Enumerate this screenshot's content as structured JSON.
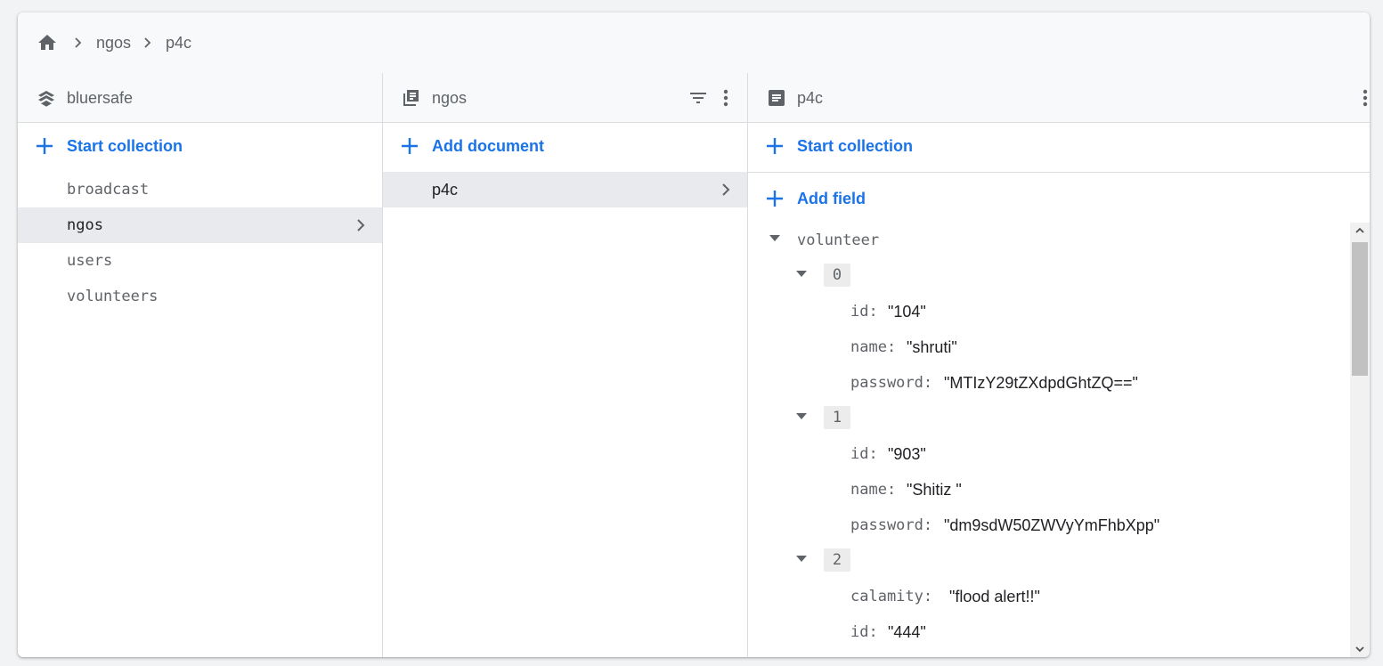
{
  "breadcrumb": {
    "home_icon": "home-icon",
    "items": [
      "ngos",
      "p4c"
    ]
  },
  "project_column": {
    "title": "bluersafe",
    "icon": "firestore-stack-icon",
    "start_collection_label": "Start collection",
    "collections": [
      "broadcast",
      "ngos",
      "users",
      "volunteers"
    ],
    "selected": "ngos"
  },
  "collection_column": {
    "title": "ngos",
    "icon": "collection-icon",
    "add_document_label": "Add document",
    "documents": [
      "p4c"
    ],
    "selected": "p4c"
  },
  "document_column": {
    "title": "p4c",
    "icon": "document-icon",
    "start_collection_label": "Start collection",
    "add_field_label": "Add field",
    "fields": {
      "root_key": "volunteer",
      "entries": [
        {
          "index": "0",
          "fields": [
            {
              "key": "id:",
              "value": "\"104\""
            },
            {
              "key": "name:",
              "value": "\"shruti\""
            },
            {
              "key": "password:",
              "value": "\"MTIzY29tZXdpdGhtZQ==\""
            }
          ]
        },
        {
          "index": "1",
          "fields": [
            {
              "key": "id:",
              "value": "\"903\""
            },
            {
              "key": "name:",
              "value": "\"Shitiz \""
            },
            {
              "key": "password:",
              "value": "\"dm9sdW50ZWVyYmFhbXpp\""
            }
          ]
        },
        {
          "index": "2",
          "fields": [
            {
              "key": "calamity:",
              "value": "\"flood alert!!\""
            },
            {
              "key": "id:",
              "value": "\"444\""
            }
          ]
        }
      ]
    }
  },
  "colors": {
    "accent": "#1a73e8",
    "selected_bg": "#e8eaed",
    "border": "#dadce0"
  }
}
